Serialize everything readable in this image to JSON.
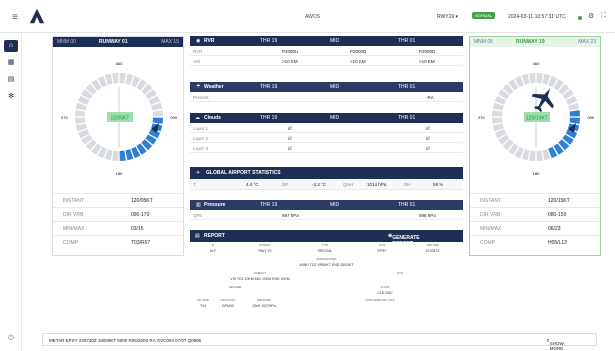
{
  "header": {
    "title": "AWOS",
    "runway_select": "RWY19",
    "status_badge": "NORMAL",
    "datetime": "2024-03-11 10:57:31 UTC",
    "icons": [
      "menu-icon",
      "settings-icon",
      "fullscreen-icon"
    ]
  },
  "sidebar": {
    "items": [
      {
        "icon": "home-icon",
        "active": true
      },
      {
        "icon": "dashboard-icon",
        "active": false
      },
      {
        "icon": "document-icon",
        "active": false
      },
      {
        "icon": "gear-icon",
        "active": false
      }
    ],
    "power_icon": "power-icon"
  },
  "left_runway": {
    "min": "MNM 00",
    "name": "RUNWAY 01",
    "max": "MAX 15",
    "wind_label": "12/05KT",
    "compass_labels": {
      "n": "360",
      "e": "090",
      "s": "180",
      "w": "270"
    },
    "stats": [
      {
        "label": "INSTANT",
        "value": "120/05KT"
      },
      {
        "label": "DIR VRB",
        "value": "090-170"
      },
      {
        "label": "MIN/MAX",
        "value": "03/15"
      },
      {
        "label": "COMP",
        "value": "T03/R07"
      }
    ]
  },
  "right_runway": {
    "min": "MNM 05",
    "name": "RUNWAY 19",
    "max": "MAX 23",
    "wind_label": "120/14KT",
    "compass_labels": {
      "n": "360",
      "e": "090",
      "s": "180",
      "w": "270"
    },
    "stats": [
      {
        "label": "INSTANT",
        "value": "120/15KT"
      },
      {
        "label": "DIR VRB",
        "value": "080-150"
      },
      {
        "label": "MIN/MAX",
        "value": "06/23"
      },
      {
        "label": "COMP",
        "value": "H05/L13"
      }
    ]
  },
  "rvr": {
    "title": "RVR",
    "cols": [
      "THR 19",
      "MID",
      "THR 01"
    ],
    "rows": [
      {
        "label": "RVR",
        "values": [
          "P2000U",
          "P2000D",
          "P2000D"
        ]
      },
      {
        "label": "VIS",
        "values": [
          ">10 KM",
          ">10 KM",
          ">10 KM"
        ]
      }
    ]
  },
  "weather": {
    "title": "Weather",
    "cols": [
      "THR 19",
      "MID",
      "THR 01"
    ],
    "rows": [
      {
        "label": "Present",
        "values": [
          "",
          "",
          "-RA"
        ]
      }
    ]
  },
  "clouds": {
    "title": "Clouds",
    "cols": [
      "THR 19",
      "MID",
      "THR 01"
    ],
    "rows": [
      {
        "label": "Layer 1",
        "values": [
          "///",
          "",
          "///"
        ]
      },
      {
        "label": "Layer 2",
        "values": [
          "///",
          "",
          "///"
        ]
      },
      {
        "label": "Layer 3",
        "values": [
          "///",
          "",
          "///"
        ]
      }
    ]
  },
  "global": {
    "title": "GLOBAL AIRPORT STATISTICS",
    "items": [
      {
        "label": "T",
        "value": "4.4 °C"
      },
      {
        "label": "DP",
        "value": "-3.3 °C"
      },
      {
        "label": "QNH",
        "value": "1014 hPa"
      },
      {
        "label": "RH",
        "value": "58 %"
      }
    ]
  },
  "pressure": {
    "title": "Pressure",
    "cols": [
      "THR 19",
      "MID",
      "THR 01"
    ],
    "rows": [
      {
        "label": "QFE",
        "values": [
          "",
          "997 hPa",
          "998 hPa"
        ]
      }
    ]
  },
  "report": {
    "title": "REPORT",
    "generate_label": "GENERATE REPORT",
    "r1_labels": [
      "ID",
      "RUNWAY",
      "TYPE",
      "ICAO",
      "OBS TIME"
    ],
    "r1_values": [
      "ALF",
      "RWY 19",
      "SPECIAL",
      "EPSY",
      "071087Z"
    ],
    "surface_label": "SURFACE WIND",
    "surface_value": "WIND TD2 VRB4KT END 050/3KT",
    "vis_label": "VISIBILITY",
    "rvr_label": "RVR",
    "vis_value": "VIS TD2 10KM MID 10KM END 10KM",
    "weather_label": "WEATHER",
    "cloud_label": "CLOUD",
    "cloud_value": "CLD NSC",
    "r5_labels": [
      "AIR TEMP",
      "DEW POINT",
      "PRESSURE",
      "SUPPLEMENTARY INFO"
    ],
    "r5_values": [
      "T04",
      "DPM03",
      "QNH 1027HPa"
    ]
  },
  "metar": {
    "text": "METAR EPSY 230730Z 18009KT 5000 R06/2000 RA OVC004 07/07 Q0995",
    "show_more": "SHOW MORE"
  }
}
